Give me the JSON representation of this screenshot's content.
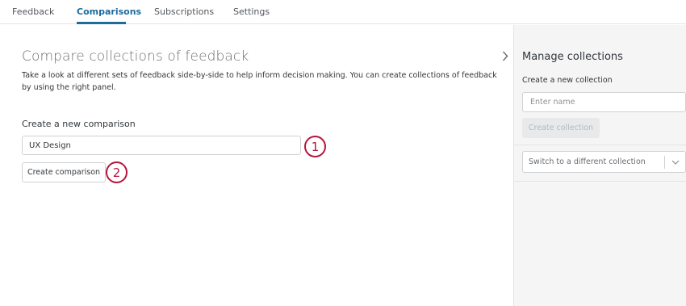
{
  "nav": {
    "tabs": [
      {
        "label": "Feedback",
        "active": false
      },
      {
        "label": "Comparisons",
        "active": true
      },
      {
        "label": "Subscriptions",
        "active": false
      },
      {
        "label": "Settings",
        "active": false
      }
    ]
  },
  "main": {
    "title": "Compare collections of feedback",
    "description": "Take a look at different sets of feedback side-by-side to help inform decision making. You can create collections of feedback by using the right panel.",
    "create_section_label": "Create a new comparison",
    "name_input_value": "UX Design",
    "create_button_label": "Create comparison"
  },
  "annotations": {
    "step1": "1",
    "step2": "2"
  },
  "panel": {
    "title": "Manage collections",
    "create_label": "Create a new collection",
    "name_placeholder": "Enter name",
    "create_button_label": "Create collection",
    "switch_select_label": "Switch to a different collection"
  },
  "colors": {
    "accent": "#1c6c9c",
    "annotation": "#b7133a",
    "panel_bg": "#f5f5f6"
  },
  "icons": {
    "collapse": "chevron-right-icon",
    "select": "chevron-down-icon"
  }
}
